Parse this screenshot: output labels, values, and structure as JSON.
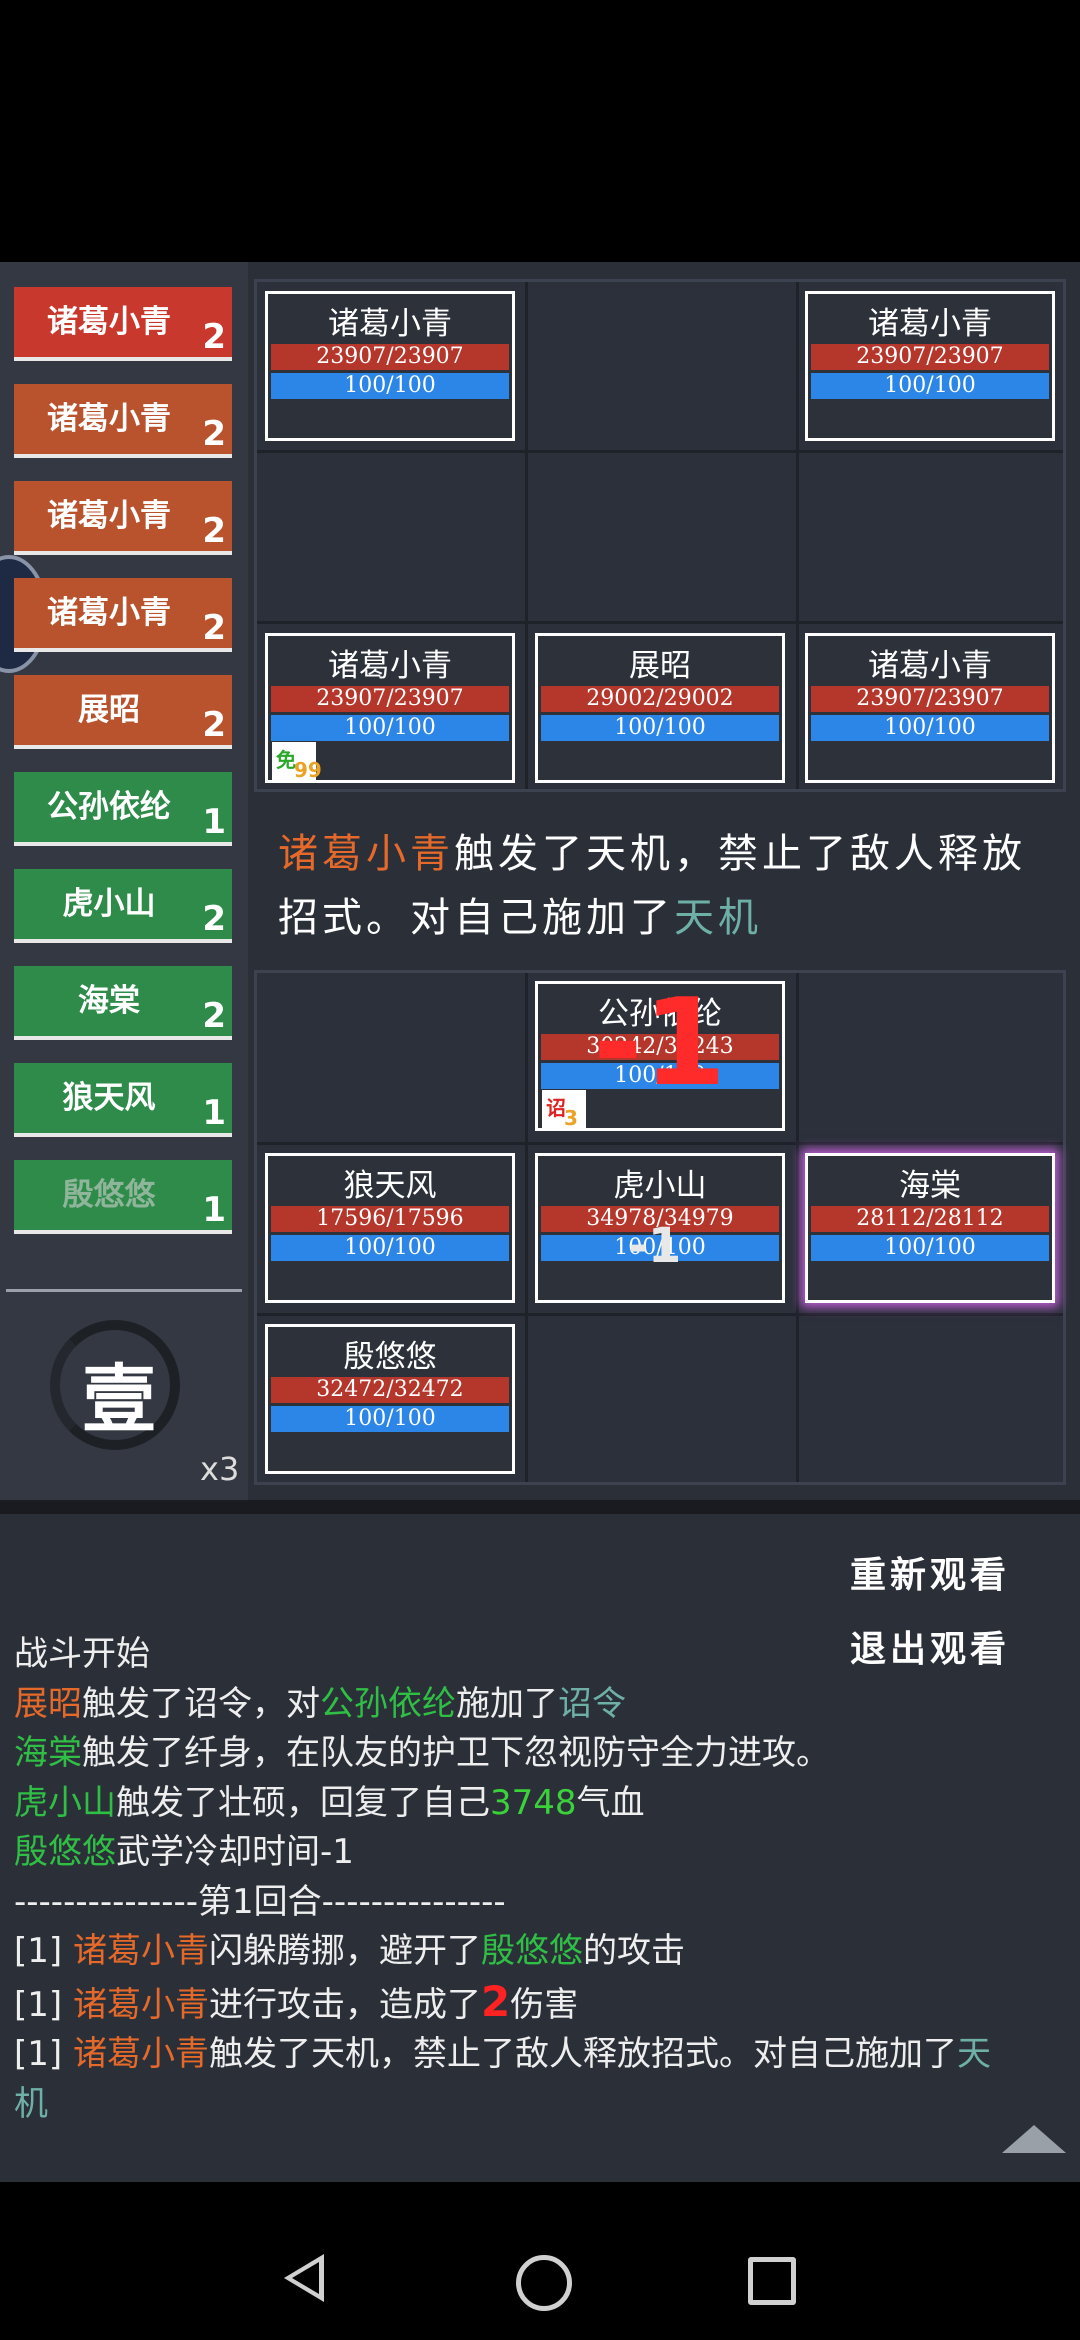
{
  "sidebar": {
    "items": [
      {
        "name": "诸葛小青",
        "level": "2"
      },
      {
        "name": "诸葛小青",
        "level": "2"
      },
      {
        "name": "诸葛小青",
        "level": "2"
      },
      {
        "name": "诸葛小青",
        "level": "2"
      },
      {
        "name": "展昭",
        "level": "2"
      },
      {
        "name": "公孙依纶",
        "level": "1"
      },
      {
        "name": "虎小山",
        "level": "2"
      },
      {
        "name": "海棠",
        "level": "2"
      },
      {
        "name": "狼天风",
        "level": "1"
      },
      {
        "name": "殷悠悠",
        "level": "1"
      }
    ],
    "round_char": "壹",
    "speed_multiplier": "x3"
  },
  "enemy_units": [
    {
      "name": "诸葛小青",
      "hp": "23907/23907",
      "mp": "100/100"
    },
    {
      "name": "诸葛小青",
      "hp": "23907/23907",
      "mp": "100/100"
    },
    {
      "name": "诸葛小青",
      "hp": "23907/23907",
      "mp": "100/100"
    },
    {
      "name": "展昭",
      "hp": "29002/29002",
      "mp": "100/100"
    },
    {
      "name": "诸葛小青",
      "hp": "23907/23907",
      "mp": "100/100"
    }
  ],
  "enemy_buff": {
    "icon_char": "免",
    "count": "99"
  },
  "center_message": {
    "actor": "诸葛小青",
    "text1": "触发了天机，禁止了敌人释放招式。对自己施加了",
    "effect": "天机"
  },
  "ally_units": [
    {
      "name": "公孙依纶",
      "hp": "30242/30243",
      "mp": "100/100"
    },
    {
      "name": "狼天风",
      "hp": "17596/17596",
      "mp": "100/100"
    },
    {
      "name": "虎小山",
      "hp": "34978/34979",
      "mp": "100/100"
    },
    {
      "name": "海棠",
      "hp": "28112/28112",
      "mp": "100/100"
    },
    {
      "name": "殷悠悠",
      "hp": "32472/32472",
      "mp": "100/100"
    }
  ],
  "ally_buff": {
    "icon_char": "诏",
    "count": "3"
  },
  "floating_damage": {
    "big": "-1",
    "small": "-1"
  },
  "buttons": {
    "replay": "重新观看",
    "exit": "退出观看"
  },
  "log": {
    "line0": "战斗开始",
    "line1": {
      "a": "展昭",
      "b": "触发了诏令，对",
      "c": "公孙依纶",
      "d": "施加了",
      "e": "诏令"
    },
    "line2": {
      "a": "海棠",
      "b": "触发了纤身，在队友的护卫下忽视防守全力进攻。"
    },
    "line3": {
      "a": "虎小山",
      "b": "触发了壮硕，回复了自己",
      "c": "3748",
      "d": "气血"
    },
    "line4": {
      "a": "殷悠悠",
      "b": "武学冷却时间-1"
    },
    "line5": "---------------第1回合---------------",
    "line6": {
      "p": "[1] ",
      "a": "诸葛小青",
      "b": "闪躲腾挪，避开了",
      "c": "殷悠悠",
      "d": "的攻击"
    },
    "line7": {
      "p": "[1] ",
      "a": "诸葛小青",
      "b": "进行攻击，造成了",
      "c": "2",
      "d": "伤害"
    },
    "line8": {
      "p": "[1] ",
      "a": "诸葛小青",
      "b": "触发了天机，禁止了敌人释放招式。对自己施加了",
      "c": "天"
    },
    "line9": "机"
  }
}
